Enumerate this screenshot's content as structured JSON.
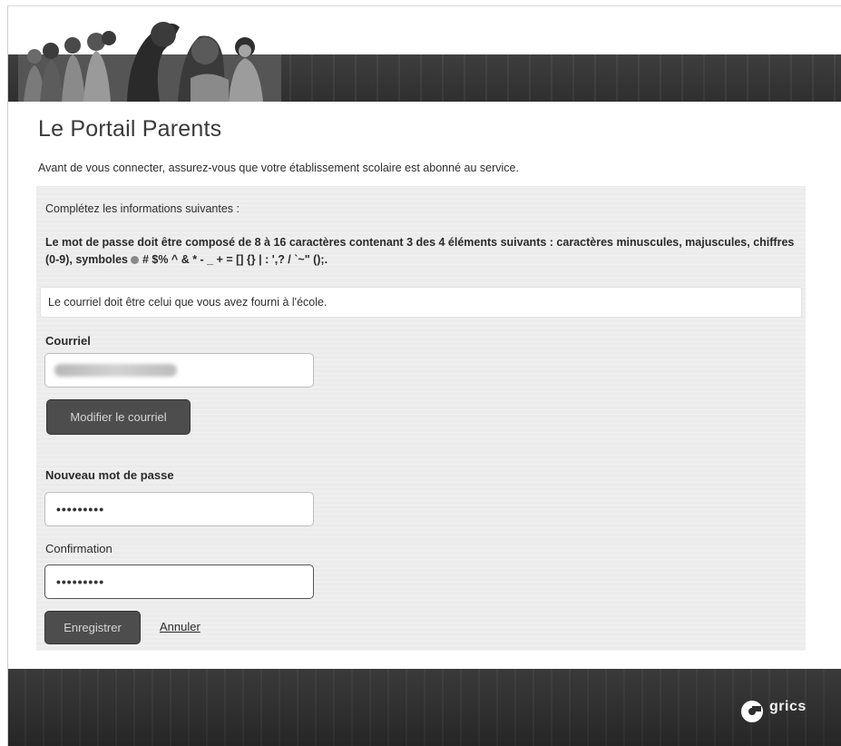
{
  "header": {
    "banner_image": "family-photo-banner"
  },
  "page": {
    "title": "Le Portail Parents",
    "intro": "Avant de vous connecter, assurez-vous que votre établissement scolaire est abonné au service."
  },
  "form": {
    "complete_label": "Complétez les informations suivantes :",
    "password_rules_part1": "Le mot de passe doit être composé de 8 à 16 caractères contenant 3 des 4 éléments suivants : caractères minuscules, majuscules, chiffres (0-9), symboles ",
    "password_rules_part2": " # $% ^ & * - _ + = [] {} | : ',? / `~\" ();.",
    "email_notice": "Le courriel doit être celui que vous avez fourni à l'école.",
    "email_label": "Courriel",
    "email_value": "",
    "modify_email_button": "Modifier le courriel",
    "new_password_label": "Nouveau mot de passe",
    "new_password_value": "•••••••••",
    "confirmation_label": "Confirmation",
    "confirmation_value": "•••••••••",
    "save_button": "Enregistrer",
    "cancel_link": "Annuler"
  },
  "footer": {
    "logo_text": "grics",
    "logo_icon": "grics-logo-icon"
  },
  "colors": {
    "banner": "#333333",
    "button": "#4d4d4d",
    "panel": "#ececec"
  }
}
